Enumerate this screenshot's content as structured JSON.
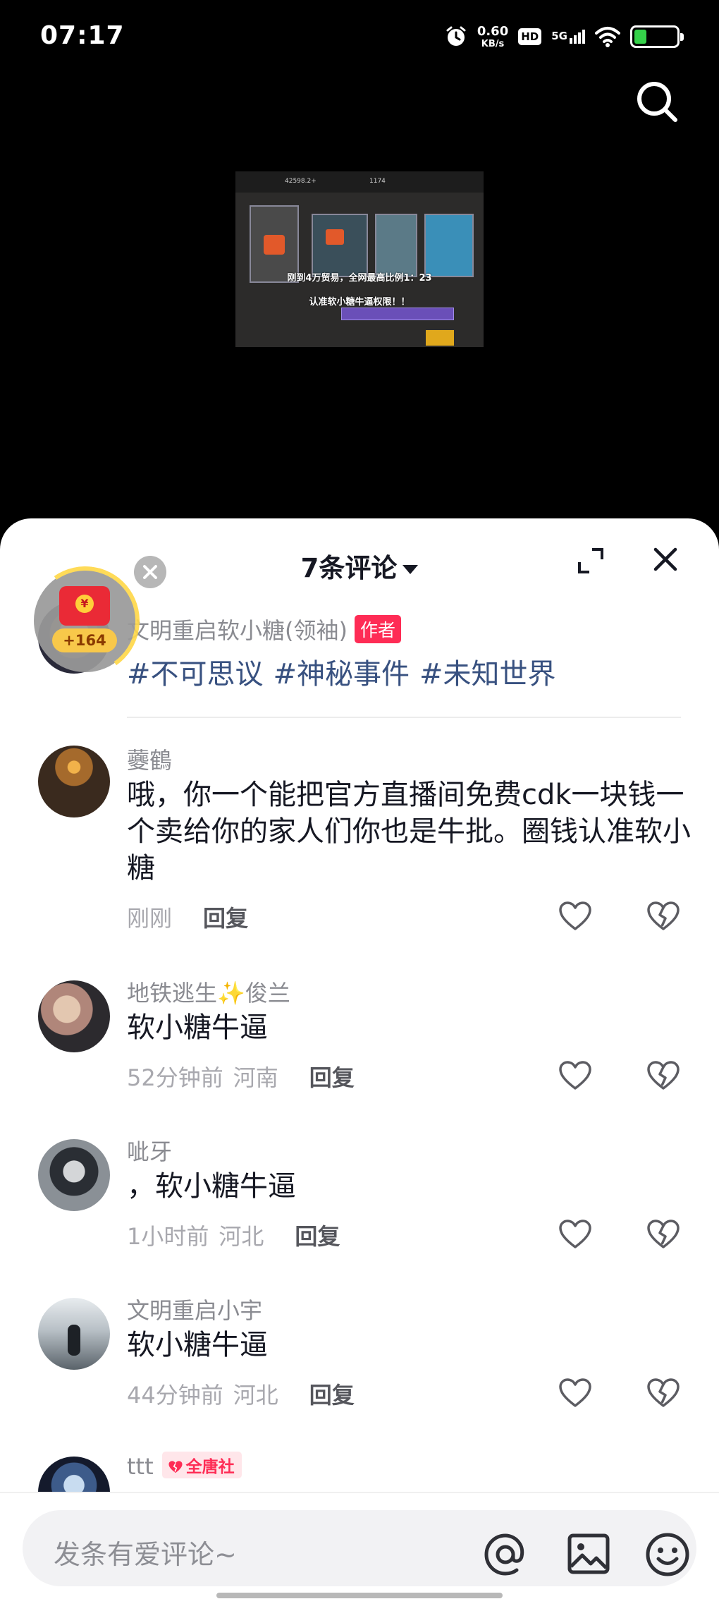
{
  "status_bar": {
    "time": "07:17",
    "net_speed_value": "0.60",
    "net_speed_unit": "KB/s",
    "hd_badge": "HD",
    "network_type": "5G",
    "battery_level": 0.3,
    "icons": [
      "alarm-icon",
      "hd-icon",
      "signal-icon",
      "wifi-icon",
      "battery-icon"
    ]
  },
  "video": {
    "caption_line1": "刚到4万贸易，全网最高比例1：23",
    "caption_line2": "认准软小糖牛逼权限！！",
    "top_value_left": "42598.2+",
    "top_value_mid": "1174"
  },
  "comment_sheet": {
    "title": "7条评论"
  },
  "red_packet": {
    "coin_symbol": "¥",
    "badge": "+164"
  },
  "author_post": {
    "username": "文明重启软小糖(领袖)",
    "author_tag": "作者",
    "hashtags": [
      "#不可思议",
      "#神秘事件",
      "#未知世界"
    ]
  },
  "comments": [
    {
      "username": "虁鶴",
      "text": "哦，你一个能把官方直播间免费cdk一块钱一个卖给你的家人们你也是牛批。圈钱认准软小糖",
      "time": "刚刚",
      "location": "",
      "reply_label": "回复"
    },
    {
      "username": "地铁逃生✨俊兰",
      "text": "软小糖牛逼",
      "time": "52分钟前",
      "location": "河南",
      "reply_label": "回复"
    },
    {
      "username": "呲牙",
      "text": "，软小糖牛逼",
      "time": "1小时前",
      "location": "河北",
      "reply_label": "回复"
    },
    {
      "username": "文明重启小宇",
      "text": "软小糖牛逼",
      "time": "44分钟前",
      "location": "河北",
      "reply_label": "回复"
    },
    {
      "username": "ttt",
      "fan_badge": "全唐社"
    }
  ],
  "input": {
    "placeholder": "发条有爱评论~"
  },
  "colors": {
    "accent": "#fe2c55",
    "hashtag": "#385180",
    "text_primary": "#161823",
    "text_secondary": "#8a8b91"
  }
}
